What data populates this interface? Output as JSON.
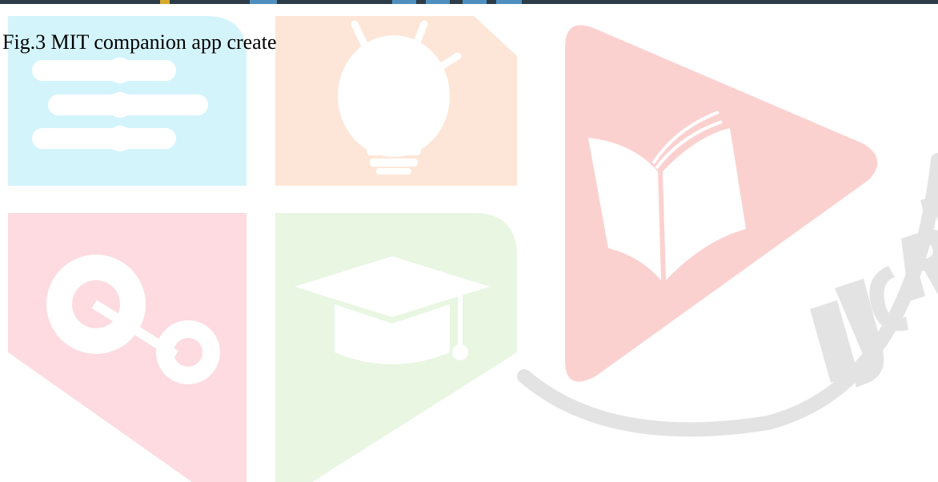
{
  "document": {
    "figure_caption": "Fig.3 MIT companion app create"
  },
  "watermark": {
    "logo_letters": "IJCRT",
    "colors": {
      "cyan": "#d4f4fc",
      "orange": "#fde6d7",
      "pink": "#fddbe0",
      "green": "#e8f6e2",
      "red": "#fbd1d0",
      "gray": "#e3e3e3"
    }
  }
}
